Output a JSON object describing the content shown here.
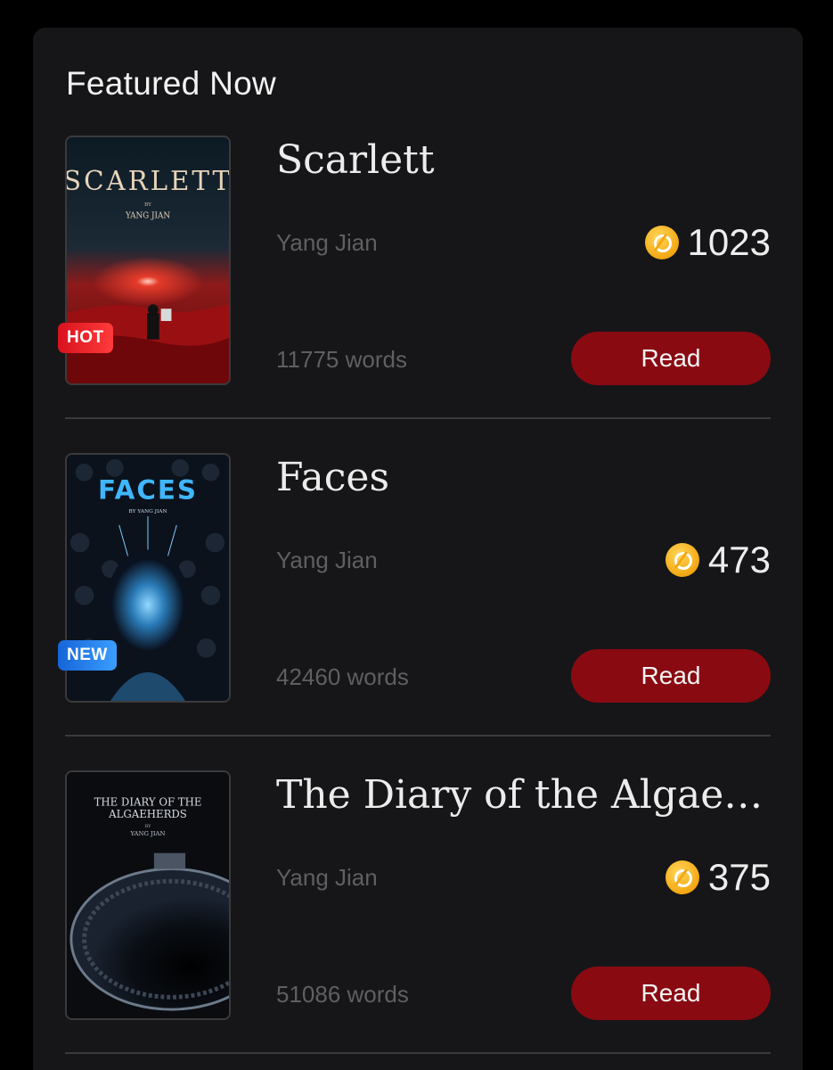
{
  "section": {
    "title": "Featured Now"
  },
  "books": [
    {
      "title": "Scarlett",
      "author": "Yang Jian",
      "coins": "1023",
      "words": "11775 words",
      "badge": "HOT",
      "read_label": "Read",
      "cover": {
        "title": "SCARLETT",
        "by": "BY",
        "author": "YANG JIAN"
      }
    },
    {
      "title": "Faces",
      "author": "Yang Jian",
      "coins": "473",
      "words": "42460 words",
      "badge": "NEW",
      "read_label": "Read",
      "cover": {
        "title": "FACES",
        "byline": "BY YANG JIAN"
      }
    },
    {
      "title": "The Diary of the Algaehe...",
      "author": "Yang Jian",
      "coins": "375",
      "words": "51086 words",
      "badge": "",
      "read_label": "Read",
      "cover": {
        "title_line1": "THE DIARY OF THE",
        "title_line2": "ALGAEHERDS",
        "by": "BY",
        "author": "YANG JIAN"
      }
    }
  ],
  "icons": {
    "coin": "coin-icon"
  },
  "colors": {
    "accent": "#8a0a12",
    "background": "#161618",
    "hot_badge": "#e3141f",
    "new_badge": "#2a7be8"
  }
}
